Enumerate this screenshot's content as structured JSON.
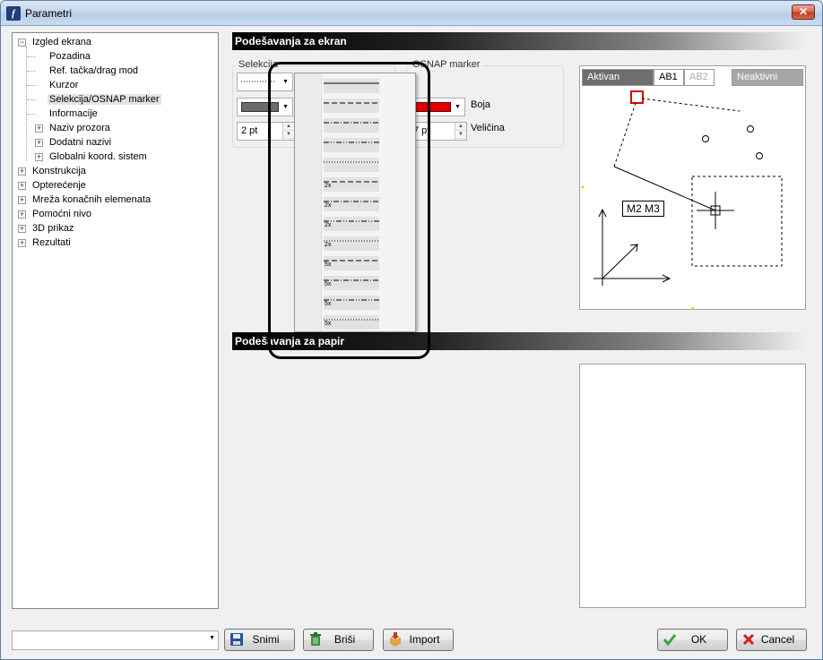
{
  "window": {
    "title": "Parametri",
    "close_glyph": "✕"
  },
  "tree": {
    "items": [
      {
        "label": "Izgled ekrana",
        "level": 0,
        "expander": "−"
      },
      {
        "label": "Pozadina",
        "level": 1
      },
      {
        "label": "Ref. tačka/drag mod",
        "level": 1
      },
      {
        "label": "Kurzor",
        "level": 1
      },
      {
        "label": "Selekcija/OSNAP marker",
        "level": 1,
        "selected": true
      },
      {
        "label": "Informacije",
        "level": 1
      },
      {
        "label": "Naziv prozora",
        "level": 1,
        "expander": "+"
      },
      {
        "label": "Dodatni nazivi",
        "level": 1,
        "expander": "+"
      },
      {
        "label": "Globalni koord. sistem",
        "level": 1,
        "expander": "+"
      },
      {
        "label": "Konstrukcija",
        "level": 0,
        "expander": "+"
      },
      {
        "label": "Opterećenje",
        "level": 0,
        "expander": "+"
      },
      {
        "label": "Mreža konačnih elemenata",
        "level": 0,
        "expander": "+"
      },
      {
        "label": "Pomoćni nivo",
        "level": 0,
        "expander": "+"
      },
      {
        "label": "3D prikaz",
        "level": 0,
        "expander": "+"
      },
      {
        "label": "Rezultati",
        "level": 0,
        "expander": "+"
      }
    ]
  },
  "screen_section": {
    "title": "Podešavanja za ekran",
    "selection_group": {
      "label": "Selekcija",
      "size_value": "2 pt"
    },
    "osnap_group": {
      "label": "OSNAP marker",
      "size_value": "7 pt",
      "color": "#e00000"
    },
    "color_label": "Boja",
    "size_label": "Veličina"
  },
  "paper_section": {
    "title": "Podešavanja za papir"
  },
  "preview": {
    "tab_active": "Aktivan",
    "tab_ab1": "AB1",
    "tab_ab2": "AB2",
    "tab_inactive": "Neaktivni",
    "label_box": "M2 M3"
  },
  "popup": {
    "options": [
      {
        "style": "solid",
        "mult": ""
      },
      {
        "style": "dashed",
        "mult": ""
      },
      {
        "style": "dashdot",
        "mult": ""
      },
      {
        "style": "dashdotdot",
        "mult": ""
      },
      {
        "style": "dotted",
        "mult": ""
      },
      {
        "style": "dashed",
        "mult": "2x"
      },
      {
        "style": "dashdot",
        "mult": "2x"
      },
      {
        "style": "dashdotdot",
        "mult": "2x"
      },
      {
        "style": "dotted",
        "mult": "2x"
      },
      {
        "style": "dashed",
        "mult": "5x"
      },
      {
        "style": "dashdot",
        "mult": "5x"
      },
      {
        "style": "dashdotdot",
        "mult": "5x"
      },
      {
        "style": "dotted",
        "mult": "5x"
      }
    ]
  },
  "footer": {
    "preset_value": "",
    "save_label": "Snimi",
    "delete_label": "Briši",
    "import_label": "Import",
    "ok_label": "OK",
    "cancel_label": "Cancel"
  }
}
